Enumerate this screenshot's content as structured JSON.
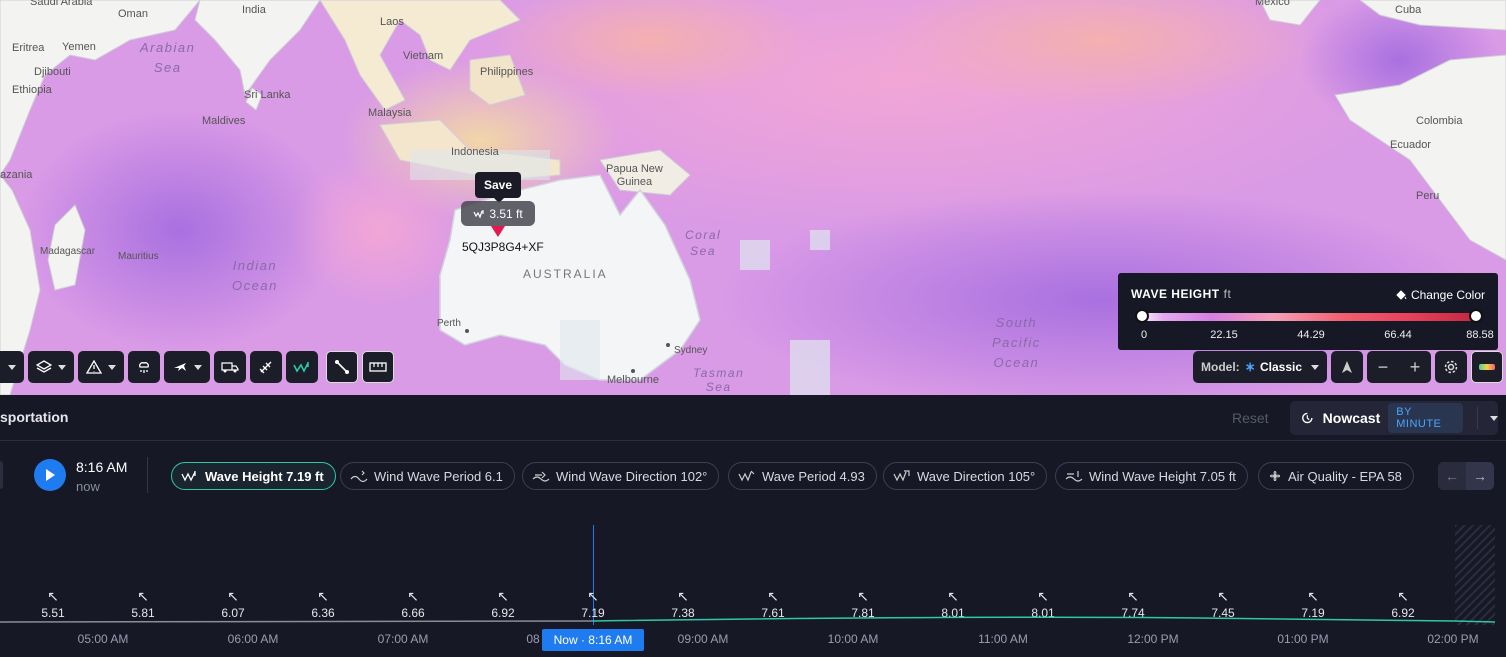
{
  "map": {
    "labels": {
      "saudi_arabia": "Saudi Arabia",
      "oman": "Oman",
      "india": "India",
      "laos": "Laos",
      "mexico": "Mexico",
      "cuba": "Cuba",
      "eritrea": "Eritrea",
      "yemen": "Yemen",
      "djibouti": "Djibouti",
      "ethiopia": "Ethiopia",
      "arabian_sea": "Arabian\nSea",
      "vietnam": "Vietnam",
      "philippines": "Philippines",
      "sri_lanka": "Sri Lanka",
      "malaysia": "Malaysia",
      "maldives": "Maldives",
      "indonesia": "Indonesia",
      "papua_new_guinea": "Papua New\nGuinea",
      "colombia": "Colombia",
      "ecuador": "Ecuador",
      "peru": "Peru",
      "tanzania": "azania",
      "madagascar": "Madagascar",
      "mauritius": "Mauritius",
      "coral_sea": "Coral\nSea",
      "australia": "AUSTRALIA",
      "indian_ocean": "Indian\nOcean",
      "south_pacific": "South\nPacific\nOcean",
      "perth": "Perth",
      "sydney": "Sydney",
      "melbourne": "Melbourne",
      "tasman": "Tasman\nSea"
    },
    "tooltip": "Save",
    "point_value": "3.51 ft",
    "plus_code": "5QJ3P8G4+XF"
  },
  "legend": {
    "title": "WAVE HEIGHT",
    "unit": "ft",
    "change_color": "Change Color",
    "ticks": [
      "0",
      "22.15",
      "44.29",
      "66.44",
      "88.58"
    ]
  },
  "model": {
    "label": "Model:",
    "value": "Classic"
  },
  "panel": {
    "title": "sportation",
    "reset": "Reset",
    "nowcast": "Nowcast",
    "nowcast_badge": "BY MINUTE",
    "time": "8:16 AM",
    "time_sub": "now"
  },
  "chips": [
    {
      "label": "Wave Height 7.19 ft",
      "icon": "wave-height-icon"
    },
    {
      "label": "Wind Wave Period 6.1",
      "icon": "wind-wave-period-icon"
    },
    {
      "label": "Wind Wave Direction 102°",
      "icon": "wind-wave-direction-icon"
    },
    {
      "label": "Wave Period 4.93",
      "icon": "wave-period-icon"
    },
    {
      "label": "Wave Direction 105°",
      "icon": "wave-direction-icon"
    },
    {
      "label": "Wind Wave Height 7.05 ft",
      "icon": "wind-wave-height-icon"
    },
    {
      "label": "Air Quality - EPA 58",
      "icon": "fan-icon"
    }
  ],
  "timeline": {
    "values": [
      "5.51",
      "5.81",
      "6.07",
      "6.36",
      "6.66",
      "6.92",
      "7.19",
      "7.38",
      "7.61",
      "7.81",
      "8.01",
      "8.01",
      "7.74",
      "7.45",
      "7.19",
      "6.92"
    ],
    "hours": [
      "05:00 AM",
      "06:00 AM",
      "07:00 AM",
      "08",
      "09:00 AM",
      "10:00 AM",
      "11:00 AM",
      "12:00 PM",
      "01:00 PM",
      "02:00 PM"
    ],
    "now_label": "Now · 8:16 AM"
  },
  "colors": {
    "accent": "#1e7cf0",
    "active_chip": "#2fc7a4",
    "pin": "#e5194d"
  }
}
